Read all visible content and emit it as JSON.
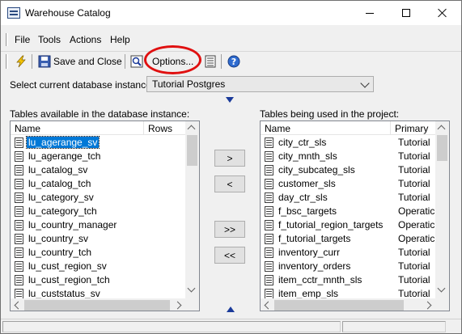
{
  "window": {
    "title": "Warehouse Catalog"
  },
  "menu": {
    "file": "File",
    "tools": "Tools",
    "actions": "Actions",
    "help": "Help"
  },
  "toolbar": {
    "save_close_label": "Save and Close",
    "options_label": "Options..."
  },
  "db_instance": {
    "label": "Select current database instance",
    "selected": "Tutorial Postgres"
  },
  "available": {
    "label": "Tables available in the database instance:",
    "columns": [
      "Name",
      "Rows"
    ],
    "rows": [
      "lu_agerange_sv",
      "lu_agerange_tch",
      "lu_catalog_sv",
      "lu_catalog_tch",
      "lu_category_sv",
      "lu_category_tch",
      "lu_country_manager",
      "lu_country_sv",
      "lu_country_tch",
      "lu_cust_region_sv",
      "lu_cust_region_tch",
      "lu_custstatus_sv"
    ],
    "selected_index": 0
  },
  "project": {
    "label": "Tables being used in the project:",
    "columns": [
      "Name",
      "Primary"
    ],
    "rows": [
      {
        "name": "city_ctr_sls",
        "primary": "Tutorial"
      },
      {
        "name": "city_mnth_sls",
        "primary": "Tutorial"
      },
      {
        "name": "city_subcateg_sls",
        "primary": "Tutorial"
      },
      {
        "name": "customer_sls",
        "primary": "Tutorial"
      },
      {
        "name": "day_ctr_sls",
        "primary": "Tutorial"
      },
      {
        "name": "f_bsc_targets",
        "primary": "Operatic"
      },
      {
        "name": "f_tutorial_region_targets",
        "primary": "Operatic"
      },
      {
        "name": "f_tutorial_targets",
        "primary": "Operatic"
      },
      {
        "name": "inventory_curr",
        "primary": "Tutorial"
      },
      {
        "name": "inventory_orders",
        "primary": "Tutorial"
      },
      {
        "name": "item_cctr_mnth_sls",
        "primary": "Tutorial"
      },
      {
        "name": "item_emp_sls",
        "primary": "Tutorial"
      }
    ]
  },
  "transfer": {
    "add_one": ">",
    "remove_one": "<",
    "add_all": ">>",
    "remove_all": "<<"
  },
  "colors": {
    "selection": "#0078d7",
    "highlight_ring": "#e01010",
    "arrow_marker": "#1a3a9a"
  }
}
